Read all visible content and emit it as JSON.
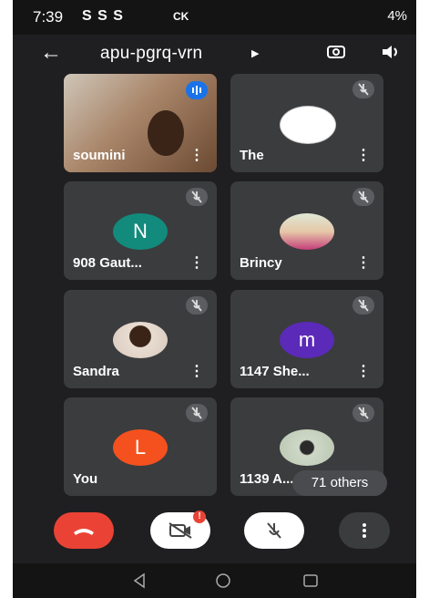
{
  "status_bar": {
    "time": "7:39",
    "app_icons": "S S S",
    "extra": "CK",
    "battery": "4%"
  },
  "app_bar": {
    "meeting_code": "apu-pgrq-vrn"
  },
  "participants": [
    {
      "name": "soumini",
      "type": "video",
      "speaking": true
    },
    {
      "name": "The",
      "type": "photo",
      "muted": true
    },
    {
      "name": "908 Gaut...",
      "initial": "N",
      "color": "#128a7c",
      "muted": true
    },
    {
      "name": "Brincy",
      "type": "photo",
      "muted": true
    },
    {
      "name": "Sandra",
      "type": "photo",
      "muted": true
    },
    {
      "name": "1147 She...",
      "initial": "m",
      "color": "#5b2ab8",
      "muted": true
    },
    {
      "name": "You",
      "initial": "L",
      "color": "#f4511e",
      "muted": true
    },
    {
      "name": "1139 A...",
      "type": "photo",
      "muted": true
    }
  ],
  "others_pill": "71 others",
  "controls": {
    "camera_badge": "!"
  },
  "colors": {
    "background": "#1f1f21",
    "tile": "#3b3c3e",
    "end_call": "#ea4335",
    "speaking_indicator": "#1a73e8"
  }
}
